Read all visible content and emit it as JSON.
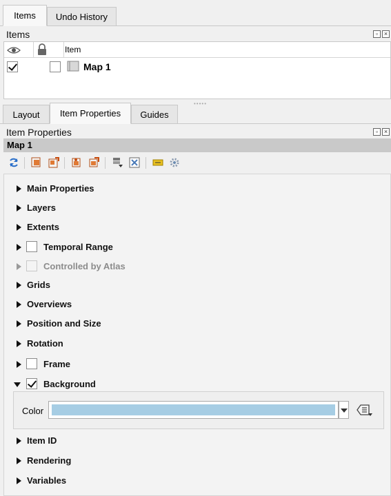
{
  "top_tabs": [
    "Items",
    "Undo History"
  ],
  "items_panel": {
    "title": "Items",
    "columns": {
      "item": "Item"
    },
    "rows": [
      {
        "label": "Map 1",
        "visible": true,
        "locked": false
      }
    ]
  },
  "middle_tabs": [
    "Layout",
    "Item Properties",
    "Guides"
  ],
  "props_panel": {
    "title": "Item Properties",
    "item_name": "Map 1",
    "sections": {
      "main_properties": "Main Properties",
      "layers": "Layers",
      "extents": "Extents",
      "temporal_range": "Temporal Range",
      "controlled_by_atlas": "Controlled by Atlas",
      "grids": "Grids",
      "overviews": "Overviews",
      "position_size": "Position and Size",
      "rotation": "Rotation",
      "frame": "Frame",
      "background": "Background",
      "item_id": "Item ID",
      "rendering": "Rendering",
      "variables": "Variables"
    },
    "background": {
      "enabled": true,
      "color_label": "Color",
      "color_value": "#a6cde4"
    },
    "frame_enabled": false,
    "temporal_enabled": false,
    "atlas_enabled": false
  },
  "icons": {
    "toolbar": [
      "refresh-icon",
      "lower-item-icon",
      "raise-item-icon",
      "to-bottom-icon",
      "to-top-icon",
      "align-icon",
      "zoom-extent-icon",
      "label-icon",
      "settings-icon"
    ]
  }
}
